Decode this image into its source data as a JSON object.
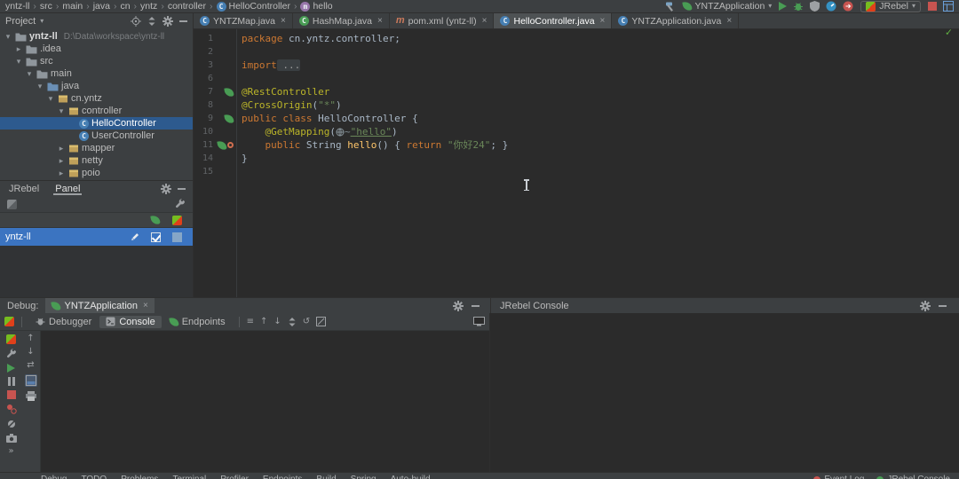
{
  "navbar": {
    "breadcrumbs": [
      {
        "label": "yntz-ll"
      },
      {
        "label": "src"
      },
      {
        "label": "main"
      },
      {
        "label": "java"
      },
      {
        "label": "cn"
      },
      {
        "label": "yntz"
      },
      {
        "label": "controller"
      },
      {
        "label": "HelloController",
        "icon": "class-icon"
      },
      {
        "label": "hello",
        "icon": "method-icon"
      }
    ],
    "run_config": {
      "label": "YNTZApplication",
      "icon": "spring-leaf-icon"
    },
    "jrebel_button": {
      "label": "JRebel",
      "icon": "jrebel-icon"
    },
    "leading_icons": [
      "build-hammer-icon"
    ],
    "action_icons": [
      "run-icon",
      "debug-bug-icon",
      "coverage-icon",
      "profiler-icon",
      "attach-icon"
    ],
    "trailing_icons": [
      "stop-icon",
      "window-layout-icon"
    ]
  },
  "project_panel": {
    "title": "Project",
    "header_icons": [
      "locate-icon",
      "collapse-all-icon",
      "settings-gear-icon",
      "hide-icon"
    ],
    "tree": [
      {
        "depth": 0,
        "arrow": "open",
        "icon": "folder-icon",
        "label": "yntz-ll",
        "extra": "D:\\Data\\workspace\\yntz-ll",
        "bold": true
      },
      {
        "depth": 1,
        "arrow": "closed",
        "icon": "folder-icon",
        "label": ".idea"
      },
      {
        "depth": 1,
        "arrow": "open",
        "icon": "folder-icon",
        "label": "src"
      },
      {
        "depth": 2,
        "arrow": "open",
        "icon": "folder-icon",
        "label": "main"
      },
      {
        "depth": 3,
        "arrow": "open",
        "icon": "folder-source-icon",
        "label": "java"
      },
      {
        "depth": 4,
        "arrow": "open",
        "icon": "package-icon",
        "label": "cn.yntz"
      },
      {
        "depth": 5,
        "arrow": "open",
        "icon": "package-icon",
        "label": "controller"
      },
      {
        "depth": 6,
        "arrow": null,
        "icon": "class-icon",
        "label": "HelloController",
        "selected": true
      },
      {
        "depth": 6,
        "arrow": null,
        "icon": "class-icon",
        "label": "UserController"
      },
      {
        "depth": 5,
        "arrow": "closed",
        "icon": "package-icon",
        "label": "mapper"
      },
      {
        "depth": 5,
        "arrow": "closed",
        "icon": "package-icon",
        "label": "netty"
      },
      {
        "depth": 5,
        "arrow": "closed",
        "icon": "package-icon",
        "label": "poio"
      }
    ]
  },
  "jrebel_panel": {
    "tabs": [
      "JRebel",
      "Panel"
    ],
    "selected_tab": "Panel",
    "header_icons": [
      "settings-gear-icon",
      "hide-icon"
    ],
    "toolbar_left_icons": [
      "jrebel-gray-icon"
    ],
    "toolbar_right_icons": [
      "wrench-icon"
    ],
    "column_icons": [
      "jrebel-reload-icon",
      "jrebel-remote-icon"
    ],
    "row": {
      "label": "yntz-ll",
      "checked": true
    }
  },
  "editor": {
    "tabs": [
      {
        "label": "YNTZMap.java",
        "icon": "class-icon"
      },
      {
        "label": "HashMap.java",
        "icon": "class-green-icon"
      },
      {
        "label": "pom.xml (yntz-ll)",
        "icon": "maven-icon"
      },
      {
        "label": "HelloController.java",
        "icon": "class-icon",
        "active": true
      },
      {
        "label": "YNTZApplication.java",
        "icon": "class-spring-icon"
      }
    ],
    "lines": [
      {
        "num": "1",
        "gutter": [],
        "segments": [
          {
            "t": "package",
            "c": "kw"
          },
          {
            "t": " cn.yntz.controller;",
            "c": "pl"
          }
        ]
      },
      {
        "num": "2",
        "gutter": [],
        "segments": []
      },
      {
        "num": "3",
        "gutter": [],
        "segments": [
          {
            "t": "import",
            "c": "kw"
          },
          {
            "t": " ...",
            "c": "fold"
          }
        ]
      },
      {
        "num": "6",
        "gutter": [],
        "segments": []
      },
      {
        "num": "7",
        "gutter": [
          "spring-leaf-icon"
        ],
        "segments": [
          {
            "t": "@RestController",
            "c": "ann"
          }
        ]
      },
      {
        "num": "8",
        "gutter": [],
        "segments": [
          {
            "t": "@CrossOrigin",
            "c": "ann"
          },
          {
            "t": "(",
            "c": "pl"
          },
          {
            "t": "\"*\"",
            "c": "str"
          },
          {
            "t": ")",
            "c": "pl"
          }
        ]
      },
      {
        "num": "9",
        "gutter": [
          "spring-leaf-icon"
        ],
        "segments": [
          {
            "t": "public class ",
            "c": "kw"
          },
          {
            "t": "HelloController ",
            "c": "pl"
          },
          {
            "t": "{",
            "c": "pl"
          }
        ]
      },
      {
        "num": "10",
        "gutter": [],
        "segments": [
          {
            "t": "    ",
            "c": "pl"
          },
          {
            "t": "@GetMapping",
            "c": "ann"
          },
          {
            "t": "(",
            "c": "pl"
          },
          {
            "icon": "url-inlay-icon"
          },
          {
            "t": "~",
            "c": "inlay"
          },
          {
            "t": "\"hello\"",
            "c": "strlink"
          },
          {
            "t": ")",
            "c": "pl"
          }
        ]
      },
      {
        "num": "11",
        "gutter": [
          "spring-leaf-icon",
          "endpoint-icon"
        ],
        "segments": [
          {
            "t": "    ",
            "c": "pl"
          },
          {
            "t": "public",
            "c": "kw"
          },
          {
            "t": " String ",
            "c": "pl"
          },
          {
            "t": "hello",
            "c": "method"
          },
          {
            "t": "() { ",
            "c": "pl"
          },
          {
            "t": "return ",
            "c": "kw"
          },
          {
            "t": "\"你好24\"",
            "c": "str"
          },
          {
            "t": "; }",
            "c": "pl"
          }
        ]
      },
      {
        "num": "14",
        "gutter": [],
        "segments": [
          {
            "t": "}",
            "c": "pl"
          }
        ]
      },
      {
        "num": "15",
        "gutter": [],
        "segments": []
      }
    ]
  },
  "debug_panel": {
    "label": "Debug:",
    "session_tab": {
      "label": "YNTZApplication",
      "icon": "spring-leaf-icon"
    },
    "header_icons": [
      "settings-gear-icon",
      "hide-icon"
    ],
    "right_title": "JRebel Console",
    "right_icons": [
      "settings-gear-icon",
      "hide-icon"
    ],
    "toolbar": {
      "leading_icons": [
        "rerun-icon"
      ],
      "tabs": [
        {
          "label": "Debugger",
          "icon": "debugger-tab-icon"
        },
        {
          "label": "Console",
          "icon": "console-tab-icon",
          "active": true
        },
        {
          "label": "Endpoints",
          "icon": "spring-leaf-icon"
        }
      ],
      "icons": [
        "soft-wrap-icon",
        "scroll-to-top-icon",
        "scroll-to-bottom-icon",
        "collapse-chevrons-icon",
        "history-icon",
        "clear-all-icon"
      ],
      "trailing_icons": [
        "monitor-icon"
      ]
    },
    "left_strip_col1": [
      "rerun-icon",
      "wrench-icon",
      "resume-icon",
      "pause-icon",
      "stop-icon",
      "view-breakpoints-icon",
      "mute-breakpoints-icon",
      "camera-icon",
      "more-icon"
    ],
    "left_strip_col2": [
      "step-up-icon",
      "step-down-icon",
      "swap-icon",
      "layout-icon",
      "print-icon"
    ]
  },
  "status_bar": {
    "left": [
      "Debug",
      "TODO",
      "Problems",
      "Terminal",
      "Profiler",
      "Endpoints",
      "Build",
      "Spring",
      "Auto-build"
    ],
    "right": [
      {
        "label": "Event Log",
        "icon": "red-dot-icon"
      },
      {
        "label": "JRebel Console",
        "icon": "green-dot-icon"
      }
    ]
  },
  "colors": {
    "panel_bg": "#3c3f41",
    "editor_bg": "#2b2b2b",
    "selection_blue": "#2d5a8e",
    "row_blue": "#3b74c1",
    "spring_green": "#499c54",
    "error_red": "#c75450",
    "keyword_orange": "#cc7832",
    "string_green": "#6a8759",
    "annotation_yellow": "#bbb529"
  }
}
